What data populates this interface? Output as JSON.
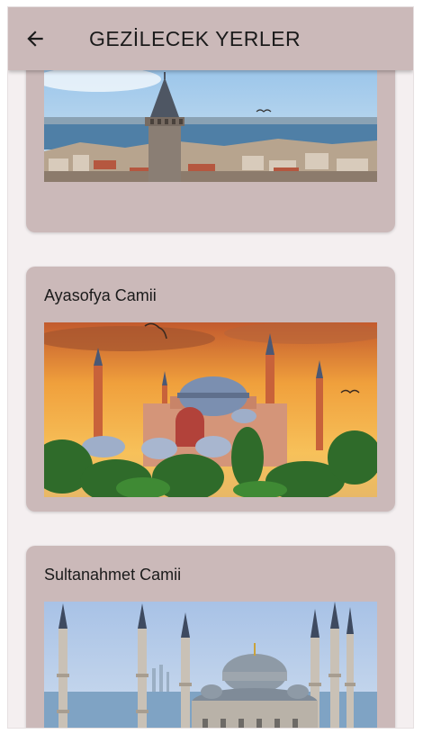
{
  "appbar": {
    "title": "GEZİLECEK YERLER",
    "back_icon": "arrow-left-icon"
  },
  "places": [
    {
      "name": "",
      "image": "galata-tower-photo"
    },
    {
      "name": "Ayasofya Camii",
      "image": "hagia-sophia-photo"
    },
    {
      "name": "Sultanahmet Camii",
      "image": "blue-mosque-photo"
    }
  ],
  "colors": {
    "appbar_bg": "#cbb9b9",
    "card_bg": "#cbb9b9",
    "page_bg": "#f4eff0"
  }
}
